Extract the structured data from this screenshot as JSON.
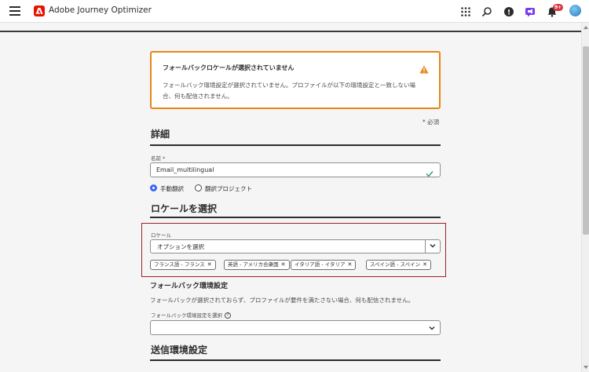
{
  "app": {
    "title": "Adobe Journey Optimizer",
    "notification_count": "9+"
  },
  "header_icons": [
    "grid-icon",
    "search-icon",
    "help-icon",
    "megaphone-icon",
    "bell-icon",
    "avatar"
  ],
  "alert": {
    "title": "フォールバックロケールが選択されていません",
    "body": "フォールバック環境設定が選択されていません。プロファイルが以下の環境設定と一致しない場合、何も配信されません。"
  },
  "required_note": "* 必須",
  "details": {
    "heading": "詳細",
    "name_label": "名前 *",
    "name_value": "Email_multilingual",
    "radio_manual": "手動翻訳",
    "radio_project": "翻訳プロジェクト",
    "radio_selected": "manual"
  },
  "locale_section": {
    "heading": "ロケールを選択",
    "field_label": "ロケール",
    "placeholder": "オプションを選択",
    "tags": [
      "フランス語 - フランス",
      "英語 - アメリカ合衆国",
      "イタリア語 - イタリア",
      "スペイン語 - スペイン"
    ]
  },
  "fallback": {
    "heading": "フォールバック環境設定",
    "description": "フォールバックが選択されておらず、プロファイルが要件を満たさない場合、何も配信されません。",
    "field_label": "フォールバック環境設定を選択",
    "value": ""
  },
  "send_settings": {
    "heading": "送信環境設定"
  },
  "colors": {
    "accent": "#3b63fb",
    "warning": "#e68619",
    "highlight_border": "#9b2226",
    "brand": "#eb1000"
  }
}
